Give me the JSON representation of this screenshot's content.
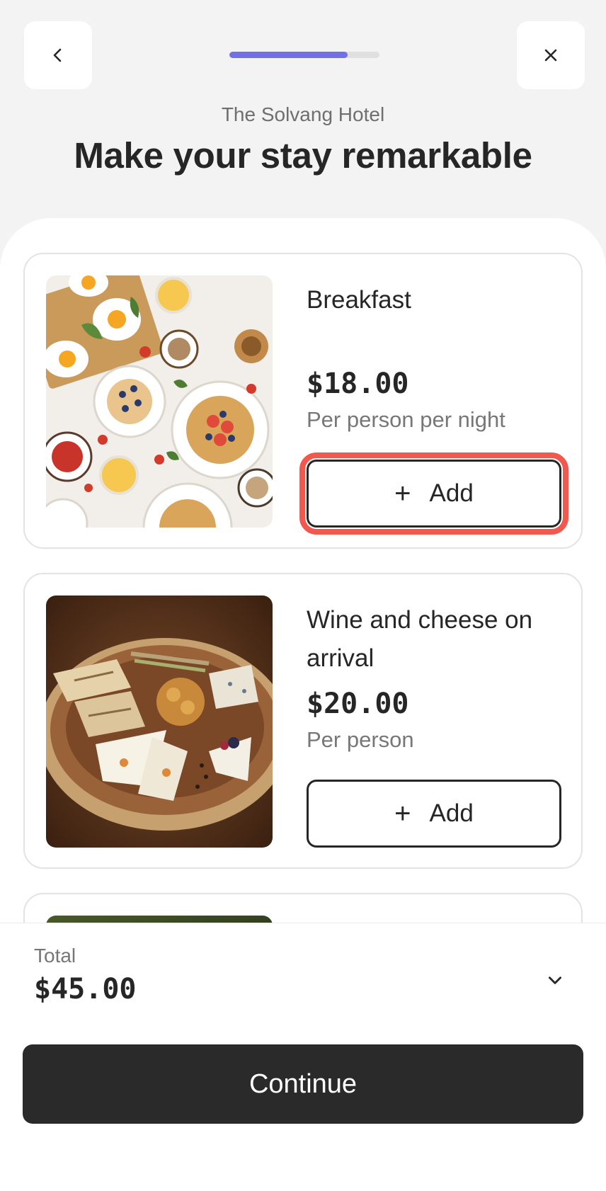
{
  "header": {
    "back_icon": "chevron-left-icon",
    "close_icon": "close-icon",
    "progress_fraction": 0.79,
    "progress_color": "#7270e6",
    "hotel_name": "The Solvang Hotel",
    "title": "Make your stay remarkable"
  },
  "addons": [
    {
      "name": "Breakfast",
      "price": "$18.00",
      "unit": "Per person per night",
      "add_label": "Add",
      "add_icon": "plus-icon",
      "highlighted": true
    },
    {
      "name": "Wine and cheese on arrival",
      "price": "$20.00",
      "unit": "Per person",
      "add_label": "Add",
      "add_icon": "plus-icon",
      "highlighted": false
    }
  ],
  "footer": {
    "total_label": "Total",
    "total_value": "$45.00",
    "expand_icon": "chevron-down-icon",
    "continue_label": "Continue"
  },
  "colors": {
    "accent": "#7270e6",
    "highlight": "#f1594e",
    "dark": "#262626"
  }
}
